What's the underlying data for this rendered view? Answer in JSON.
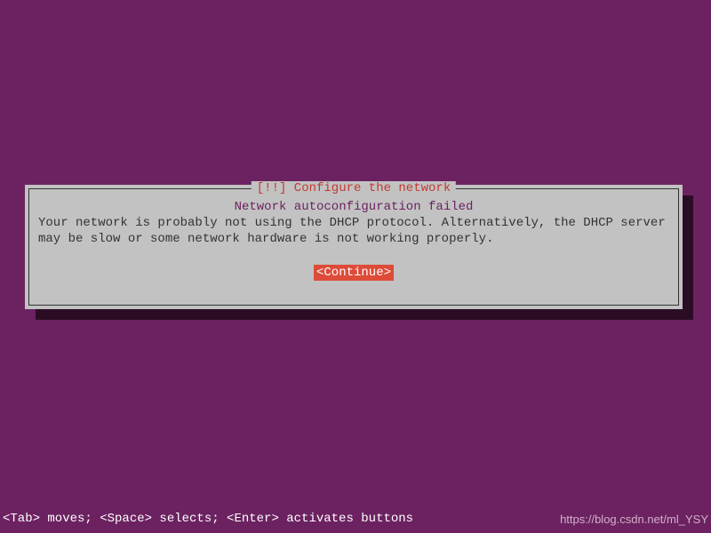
{
  "dialog": {
    "title": "[!!] Configure the network",
    "subtitle": "Network autoconfiguration failed",
    "message": "Your network is probably not using the DHCP protocol. Alternatively, the DHCP server may be slow or some network hardware is not working properly.",
    "continue_label": "<Continue>"
  },
  "statusbar": {
    "help": "<Tab> moves; <Space> selects; <Enter> activates buttons",
    "watermark": "https://blog.csdn.net/ml_YSY"
  }
}
